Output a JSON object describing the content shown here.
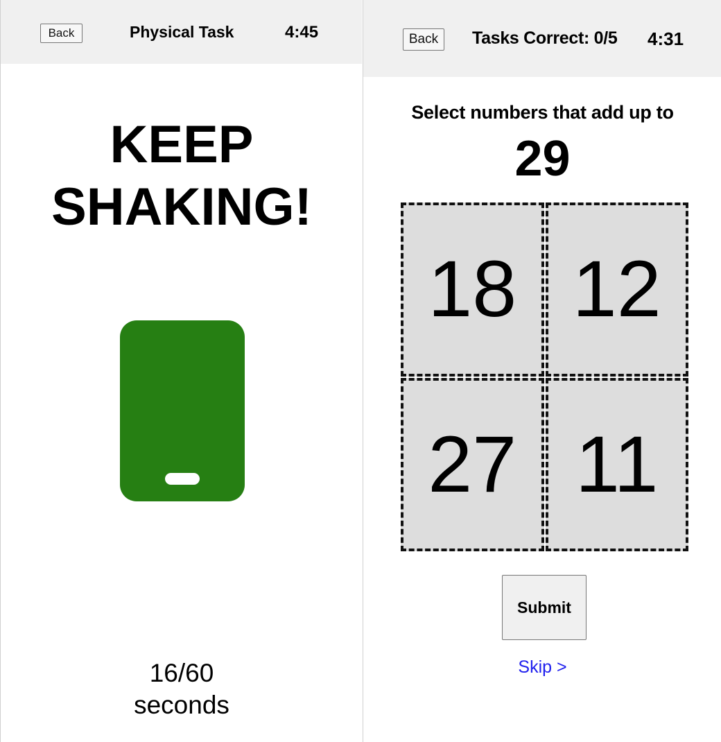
{
  "left_screen": {
    "header": {
      "back_label": "Back",
      "title": "Physical Task",
      "timer": "4:45"
    },
    "instruction_line1": "KEEP",
    "instruction_line2": "SHAKING!",
    "phone_icon": "phone-icon",
    "phone_color": "#267f13",
    "progress_count": "16/60",
    "progress_unit": "seconds"
  },
  "right_screen": {
    "header": {
      "back_label": "Back",
      "title": "Tasks Correct: 0/5",
      "timer": "4:31"
    },
    "prompt": "Select numbers that add up to",
    "target": "29",
    "numbers": [
      "18",
      "12",
      "27",
      "11"
    ],
    "submit_label": "Submit",
    "skip_label": "Skip >"
  }
}
